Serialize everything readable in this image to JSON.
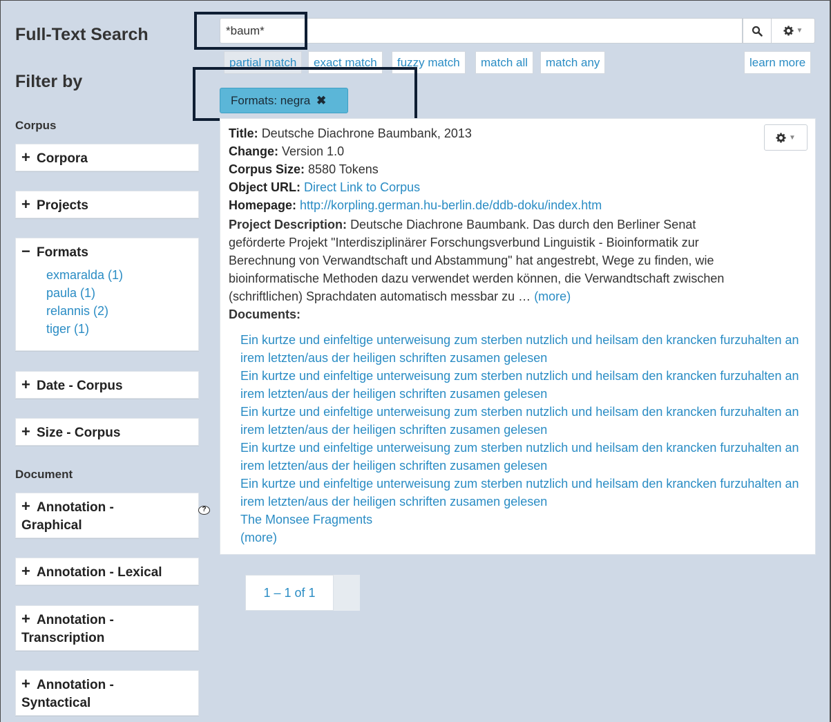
{
  "sidebar": {
    "title": "Full-Text Search",
    "filter_heading": "Filter by",
    "section_corpus": "Corpus",
    "section_document": "Document",
    "facets": [
      {
        "label": "Corpora",
        "sign": "+"
      },
      {
        "label": "Projects",
        "sign": "+"
      },
      {
        "label": "Formats",
        "sign": "−",
        "items": [
          "exmaralda (1)",
          "paula (1)",
          "relannis (2)",
          "tiger (1)"
        ]
      },
      {
        "label": "Date - Corpus",
        "sign": "+"
      },
      {
        "label": "Size - Corpus",
        "sign": "+"
      },
      {
        "label": "Annotation - Graphical",
        "sign": "+",
        "help": "?"
      },
      {
        "label": "Annotation - Lexical",
        "sign": "+"
      },
      {
        "label": "Annotation - Transcription",
        "sign": "+"
      },
      {
        "label": "Annotation - Syntactical",
        "sign": "+"
      }
    ]
  },
  "search": {
    "value": "*baum*",
    "icons": {
      "search": "search-icon",
      "settings": "gear-icon"
    },
    "modes": [
      "partial match",
      "exact match",
      "fuzzy match",
      "match all",
      "match any"
    ],
    "learn_more": "learn more",
    "active_mode": "partial match"
  },
  "active_filter": {
    "label": "Formats: negra",
    "remove": "✖"
  },
  "result": {
    "title_label": "Title:",
    "title": "Deutsche Diachrone Baumbank, 2013",
    "change_label": "Change:",
    "change": "Version 1.0",
    "size_label": "Corpus Size:",
    "size": "8580 Tokens",
    "url_label": "Object URL:",
    "url": "Direct Link to Corpus",
    "homepage_label": "Homepage:",
    "homepage": "http://korpling.german.hu-berlin.de/ddb-doku/index.htm",
    "desc_label": "Project Description:",
    "desc_lines": [
      "Deutsche Diachrone Baumbank. Das durch den Berliner Senat",
      "geförderte Projekt \"Interdisziplinärer Forschungsverbund Linguistik - Bioinformatik zur",
      "Berechnung von Verwandtschaft und Abstammung\" hat angestrebt, Wege zu finden, wie",
      "bioinformatische Methoden dazu verwendet werden können, die Verwandtschaft zwischen",
      "(schriftlichen) Sprachdaten automatisch messbar zu … "
    ],
    "desc_more": "(more)",
    "documents_label": "Documents:",
    "documents": [
      "Ein kurtze und einfeltige unterweisung zum sterben nutzlich und heilsam den krancken furzuhalten an irem letzten/aus der heiligen schriften zusamen gelesen",
      "Ein kurtze und einfeltige unterweisung zum sterben nutzlich und heilsam den krancken furzuhalten an irem letzten/aus der heiligen schriften zusamen gelesen",
      "Ein kurtze und einfeltige unterweisung zum sterben nutzlich und heilsam den krancken furzuhalten an irem letzten/aus der heiligen schriften zusamen gelesen",
      "Ein kurtze und einfeltige unterweisung zum sterben nutzlich und heilsam den krancken furzuhalten an irem letzten/aus der heiligen schriften zusamen gelesen",
      "Ein kurtze und einfeltige unterweisung zum sterben nutzlich und heilsam den krancken furzuhalten an irem letzten/aus der heiligen schriften zusamen gelesen",
      "The Monsee Fragments"
    ],
    "documents_more": "(more)"
  },
  "pager": {
    "label": "1 – 1 of 1"
  },
  "colors": {
    "link": "#2a8cc4",
    "chip": "#5bb6d8",
    "background": "#cfd9e6",
    "highlight": "#0f1e33"
  }
}
